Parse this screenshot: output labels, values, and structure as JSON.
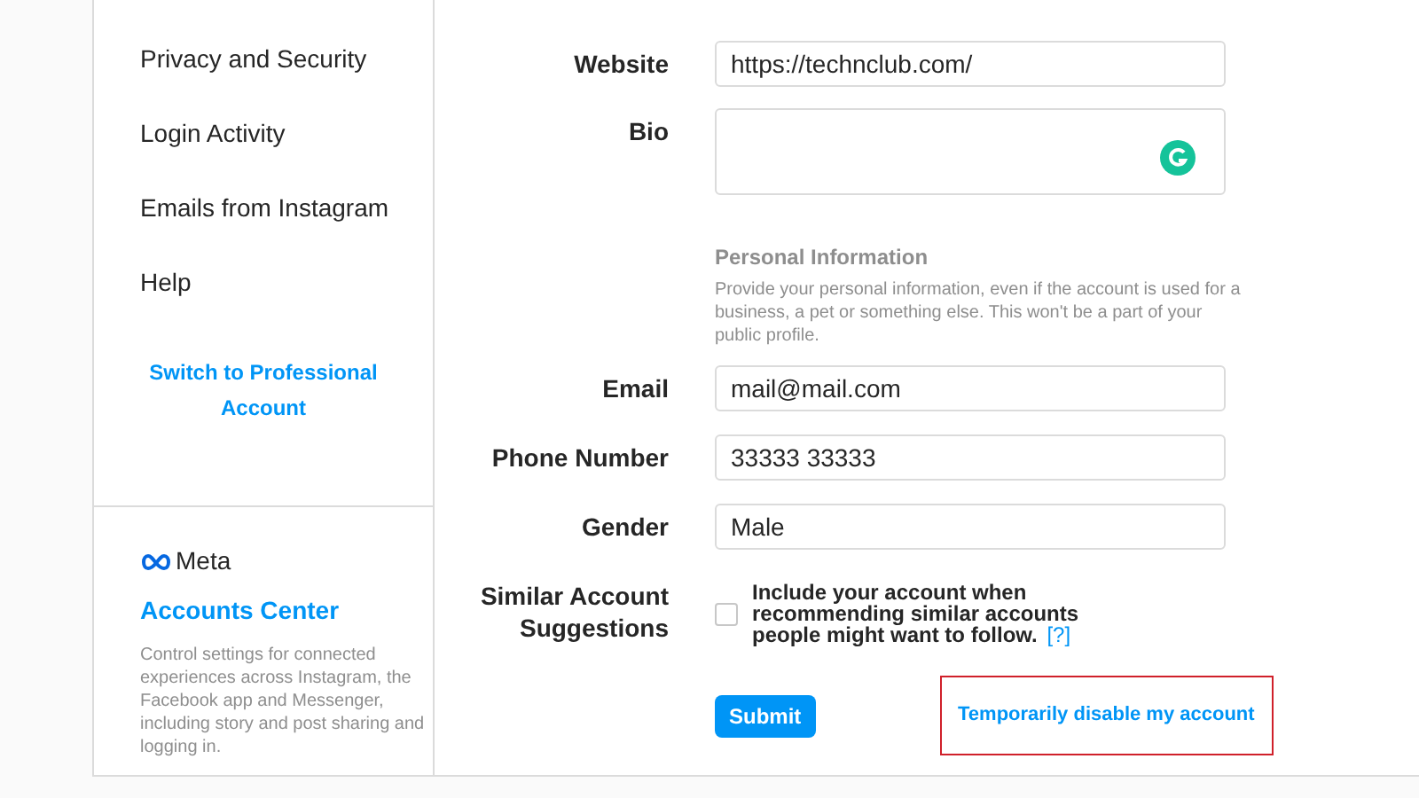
{
  "sidebar": {
    "items": [
      {
        "label": "Privacy and Security"
      },
      {
        "label": "Login Activity"
      },
      {
        "label": "Emails from Instagram"
      },
      {
        "label": "Help"
      }
    ],
    "professional_link": "Switch to Professional Account",
    "meta": {
      "logo": "Meta",
      "title": "Accounts Center",
      "description": "Control settings for connected experiences across Instagram, the Facebook app and Messenger, including story and post sharing and logging in."
    }
  },
  "form": {
    "website": {
      "label": "Website",
      "value": "https://technclub.com/"
    },
    "bio": {
      "label": "Bio"
    },
    "personal_info": {
      "title": "Personal Information",
      "description": "Provide your personal information, even if the account is used for a business, a pet or something else. This won't be a part of your public profile."
    },
    "fields": [
      {
        "label": "Email",
        "value": "mail@mail.com"
      },
      {
        "label": "Phone Number",
        "value": "33333 33333"
      },
      {
        "label": "Gender",
        "value": "Male"
      }
    ],
    "similar": {
      "label": "Similar Account Suggestions",
      "text": "Include your account when recommending similar accounts people might want to follow.",
      "help": "[?]",
      "checked": false
    },
    "submit": "Submit",
    "disable_link": "Temporarily disable my account"
  }
}
